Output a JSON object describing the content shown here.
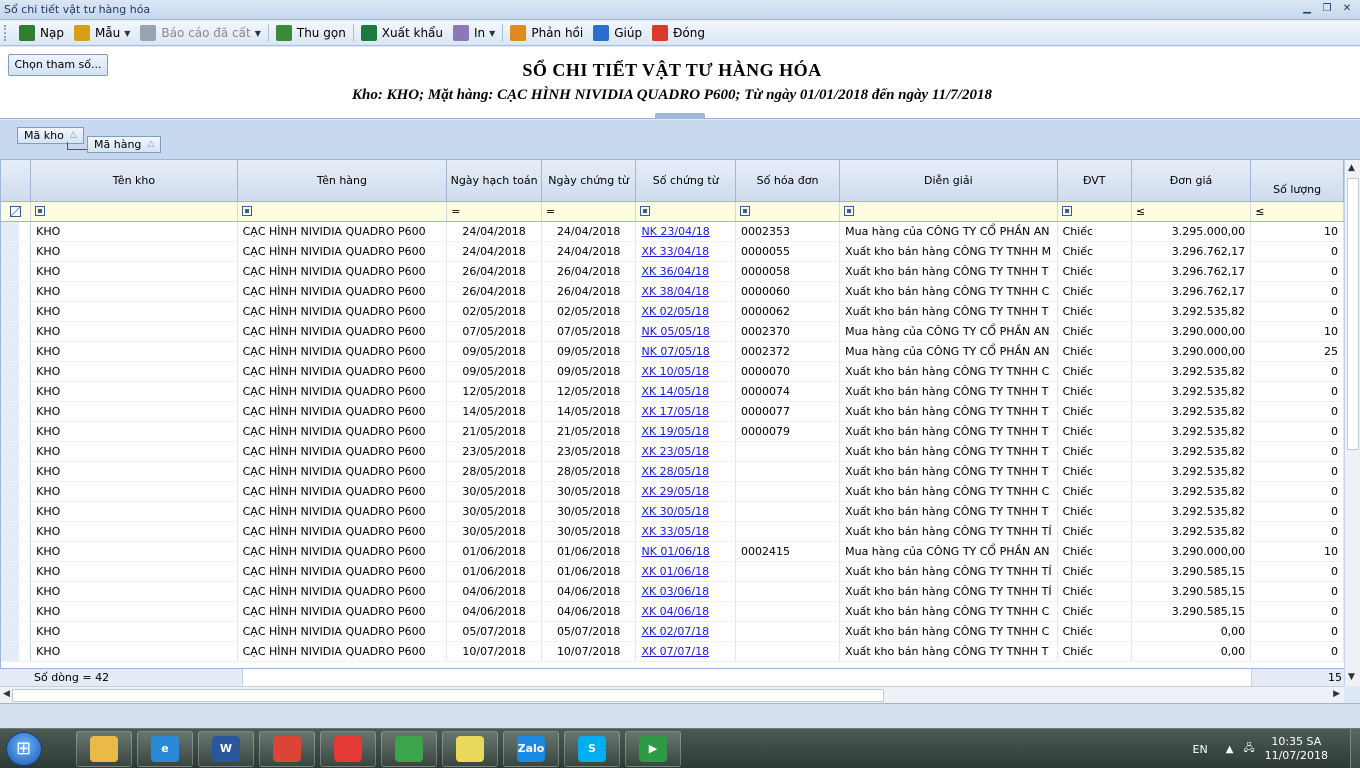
{
  "window": {
    "title": "Sổ chi tiết vật tư hàng hóa"
  },
  "toolbar": {
    "items": [
      {
        "label": "Nạp",
        "icon": "reload-icon",
        "color": "#2e7d32"
      },
      {
        "label": "Mẫu",
        "icon": "template-icon",
        "color": "#d4a017",
        "dropdown": true
      },
      {
        "label": "Báo cáo đã cất",
        "icon": "save-icon",
        "color": "#9aa4b0",
        "dropdown": true,
        "disabled": true
      },
      {
        "label": "Thu gọn",
        "icon": "collapse-icon",
        "color": "#3a8a3a"
      },
      {
        "label": "Xuất khẩu",
        "icon": "excel-icon",
        "color": "#1d7a3c"
      },
      {
        "label": "In",
        "icon": "printer-icon",
        "color": "#8a78b8",
        "dropdown": true
      },
      {
        "label": "Phản hồi",
        "icon": "mail-icon",
        "color": "#e08a1e"
      },
      {
        "label": "Giúp",
        "icon": "help-icon",
        "color": "#2a6fc9"
      },
      {
        "label": "Đóng",
        "icon": "close-icon",
        "color": "#d83b2b"
      }
    ]
  },
  "header": {
    "param_button": "Chọn tham số...",
    "title": "SỔ CHI TIẾT VẬT TƯ HÀNG HÓA",
    "subtitle": "Kho: KHO; Mặt hàng: CẠC HÌNH NIVIDIA QUADRO P600; Từ ngày 01/01/2018 đến ngày 11/7/2018"
  },
  "groupby": {
    "chip1": "Mã kho",
    "chip2": "Mã hàng"
  },
  "columns": [
    "Tên kho",
    "Tên hàng",
    "Ngày hạch toán",
    "Ngày chứng từ",
    "Số chứng từ",
    "Số hóa đơn",
    "Diễn giải",
    "ĐVT",
    "Đơn giá",
    "Số lượng"
  ],
  "filter_ops": [
    "",
    "",
    "=",
    "=",
    "",
    "",
    "",
    "",
    "≤",
    "≤"
  ],
  "rows": [
    [
      "KHO",
      "CẠC HÌNH NIVIDIA QUADRO P600",
      "24/04/2018",
      "24/04/2018",
      "NK 23/04/18",
      "0002353",
      "Mua hàng của CÔNG TY CỔ PHẦN AN",
      "Chiếc",
      "3.295.000,00",
      "10"
    ],
    [
      "KHO",
      "CẠC HÌNH NIVIDIA QUADRO P600",
      "24/04/2018",
      "24/04/2018",
      "XK 33/04/18",
      "0000055",
      "Xuất kho bán hàng CÔNG TY TNHH M",
      "Chiếc",
      "3.296.762,17",
      "0"
    ],
    [
      "KHO",
      "CẠC HÌNH NIVIDIA QUADRO P600",
      "26/04/2018",
      "26/04/2018",
      "XK 36/04/18",
      "0000058",
      "Xuất kho bán hàng CÔNG TY TNHH T",
      "Chiếc",
      "3.296.762,17",
      "0"
    ],
    [
      "KHO",
      "CẠC HÌNH NIVIDIA QUADRO P600",
      "26/04/2018",
      "26/04/2018",
      "XK 38/04/18",
      "0000060",
      "Xuất kho bán hàng CÔNG TY TNHH C",
      "Chiếc",
      "3.296.762,17",
      "0"
    ],
    [
      "KHO",
      "CẠC HÌNH NIVIDIA QUADRO P600",
      "02/05/2018",
      "02/05/2018",
      "XK 02/05/18",
      "0000062",
      "Xuất kho bán hàng CÔNG TY TNHH T",
      "Chiếc",
      "3.292.535,82",
      "0"
    ],
    [
      "KHO",
      "CẠC HÌNH NIVIDIA QUADRO P600",
      "07/05/2018",
      "07/05/2018",
      "NK 05/05/18",
      "0002370",
      "Mua hàng của CÔNG TY CỔ PHẦN AN",
      "Chiếc",
      "3.290.000,00",
      "10"
    ],
    [
      "KHO",
      "CẠC HÌNH NIVIDIA QUADRO P600",
      "09/05/2018",
      "09/05/2018",
      "NK 07/05/18",
      "0002372",
      "Mua hàng của CÔNG TY CỔ PHẦN AN",
      "Chiếc",
      "3.290.000,00",
      "25"
    ],
    [
      "KHO",
      "CẠC HÌNH NIVIDIA QUADRO P600",
      "09/05/2018",
      "09/05/2018",
      "XK 10/05/18",
      "0000070",
      "Xuất kho bán hàng CÔNG TY TNHH C",
      "Chiếc",
      "3.292.535,82",
      "0"
    ],
    [
      "KHO",
      "CẠC HÌNH NIVIDIA QUADRO P600",
      "12/05/2018",
      "12/05/2018",
      "XK 14/05/18",
      "0000074",
      "Xuất kho bán hàng CÔNG TY TNHH T",
      "Chiếc",
      "3.292.535,82",
      "0"
    ],
    [
      "KHO",
      "CẠC HÌNH NIVIDIA QUADRO P600",
      "14/05/2018",
      "14/05/2018",
      "XK 17/05/18",
      "0000077",
      "Xuất kho bán hàng CÔNG TY TNHH T",
      "Chiếc",
      "3.292.535,82",
      "0"
    ],
    [
      "KHO",
      "CẠC HÌNH NIVIDIA QUADRO P600",
      "21/05/2018",
      "21/05/2018",
      "XK 19/05/18",
      "0000079",
      "Xuất kho bán hàng CÔNG TY TNHH T",
      "Chiếc",
      "3.292.535,82",
      "0"
    ],
    [
      "KHO",
      "CẠC HÌNH NIVIDIA QUADRO P600",
      "23/05/2018",
      "23/05/2018",
      "XK 23/05/18",
      "",
      "Xuất kho bán hàng CÔNG TY TNHH T",
      "Chiếc",
      "3.292.535,82",
      "0"
    ],
    [
      "KHO",
      "CẠC HÌNH NIVIDIA QUADRO P600",
      "28/05/2018",
      "28/05/2018",
      "XK 28/05/18",
      "",
      "Xuất kho bán hàng CÔNG TY TNHH T",
      "Chiếc",
      "3.292.535,82",
      "0"
    ],
    [
      "KHO",
      "CẠC HÌNH NIVIDIA QUADRO P600",
      "30/05/2018",
      "30/05/2018",
      "XK 29/05/18",
      "",
      "Xuất kho bán hàng CÔNG TY TNHH C",
      "Chiếc",
      "3.292.535,82",
      "0"
    ],
    [
      "KHO",
      "CẠC HÌNH NIVIDIA QUADRO P600",
      "30/05/2018",
      "30/05/2018",
      "XK 30/05/18",
      "",
      "Xuất kho bán hàng CÔNG TY TNHH T",
      "Chiếc",
      "3.292.535,82",
      "0"
    ],
    [
      "KHO",
      "CẠC HÌNH NIVIDIA QUADRO P600",
      "30/05/2018",
      "30/05/2018",
      "XK 33/05/18",
      "",
      "Xuất kho bán hàng CÔNG TY TNHH TÍ",
      "Chiếc",
      "3.292.535,82",
      "0"
    ],
    [
      "KHO",
      "CẠC HÌNH NIVIDIA QUADRO P600",
      "01/06/2018",
      "01/06/2018",
      "NK 01/06/18",
      "0002415",
      "Mua hàng của CÔNG TY CỔ PHẦN AN",
      "Chiếc",
      "3.290.000,00",
      "10"
    ],
    [
      "KHO",
      "CẠC HÌNH NIVIDIA QUADRO P600",
      "01/06/2018",
      "01/06/2018",
      "XK 01/06/18",
      "",
      "Xuất kho bán hàng CÔNG TY TNHH TÍ",
      "Chiếc",
      "3.290.585,15",
      "0"
    ],
    [
      "KHO",
      "CẠC HÌNH NIVIDIA QUADRO P600",
      "04/06/2018",
      "04/06/2018",
      "XK 03/06/18",
      "",
      "Xuất kho bán hàng CÔNG TY TNHH TÍ",
      "Chiếc",
      "3.290.585,15",
      "0"
    ],
    [
      "KHO",
      "CẠC HÌNH NIVIDIA QUADRO P600",
      "04/06/2018",
      "04/06/2018",
      "XK 04/06/18",
      "",
      "Xuất kho bán hàng CÔNG TY TNHH C",
      "Chiếc",
      "3.290.585,15",
      "0"
    ],
    [
      "KHO",
      "CẠC HÌNH NIVIDIA QUADRO P600",
      "05/07/2018",
      "05/07/2018",
      "XK 02/07/18",
      "",
      "Xuất kho bán hàng CÔNG TY TNHH C",
      "Chiếc",
      "0,00",
      "0"
    ],
    [
      "KHO",
      "CẠC HÌNH NIVIDIA QUADRO P600",
      "10/07/2018",
      "10/07/2018",
      "XK 07/07/18",
      "",
      "Xuất kho bán hàng CÔNG TY TNHH T",
      "Chiếc",
      "0,00",
      "0"
    ]
  ],
  "footer": {
    "row_count": "Số dòng = 42",
    "sum_partial": "15"
  },
  "taskbar": {
    "apps": [
      {
        "name": "file-explorer-icon",
        "label": "",
        "color": "#e9b94a"
      },
      {
        "name": "internet-explorer-icon",
        "label": "e",
        "color": "#2a8ad8"
      },
      {
        "name": "word-icon",
        "label": "W",
        "color": "#2b579a"
      },
      {
        "name": "chrome-icon",
        "label": "",
        "color": "#db4437"
      },
      {
        "name": "app-pinwheel-icon",
        "label": "",
        "color": "#e53935"
      },
      {
        "name": "coccoc-icon",
        "label": "",
        "color": "#3aa54a"
      },
      {
        "name": "sticky-notes-icon",
        "label": "",
        "color": "#e9d85a"
      },
      {
        "name": "zalo-icon",
        "label": "Zalo",
        "color": "#1a8ae5"
      },
      {
        "name": "skype-icon",
        "label": "S",
        "color": "#00aff0"
      },
      {
        "name": "presentation-icon",
        "label": "▶",
        "color": "#2e9a48"
      }
    ],
    "lang": "EN",
    "time": "10:35 SA",
    "date": "11/07/2018"
  }
}
